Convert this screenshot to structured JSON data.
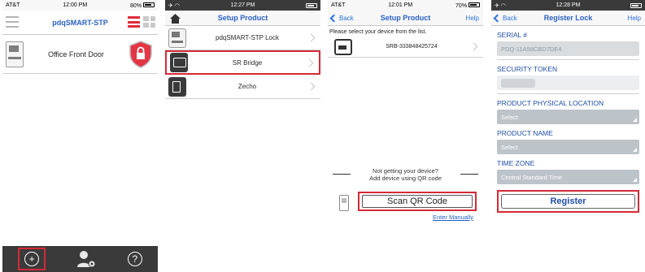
{
  "colors": {
    "accent": "#2a60c6",
    "highlight": "#d42a37",
    "dark_bar": "#3a3a3a"
  },
  "s1": {
    "status": {
      "carrier": "AT&T",
      "time": "12:00 PM",
      "battery": "80%"
    },
    "title": "pdqSMART-STP",
    "device_name": "Office Front Door",
    "tabs": {
      "add_icon": "plus-circle-icon",
      "users_icon": "user-gear-icon",
      "help_icon": "question-circle-icon"
    },
    "help_glyph": "?"
  },
  "s2": {
    "status": {
      "time": "12:27 PM"
    },
    "title": "Setup Product",
    "products": [
      "pdqSMART-STP Lock",
      "SR Bridge",
      "Zecho"
    ]
  },
  "s3": {
    "status": {
      "carrier": "AT&T",
      "time": "12:01 PM",
      "battery": "70%"
    },
    "back": "Back",
    "title": "Setup Product",
    "help": "Help",
    "instruction": "Please select your device from the list.",
    "device": "SRB-333848425724",
    "not_getting_1": "Not getting your device?",
    "not_getting_2": "Add device using QR code",
    "scan_qr": "Scan QR Code",
    "enter_manually": "Enter Manually"
  },
  "s4": {
    "status": {
      "time": "12:28 PM"
    },
    "back": "Back",
    "title": "Register Lock",
    "help": "Help",
    "serial_label": "SERIAL #",
    "serial_value": "PDQ-11A58CBD7DE4",
    "token_label": "SECURITY TOKEN",
    "location_label": "PRODUCT PHYSICAL LOCATION",
    "location_value": "Select",
    "product_label": "PRODUCT NAME",
    "product_value": "Select",
    "tz_label": "TIME ZONE",
    "tz_value": "Central Standard Time",
    "register": "Register"
  }
}
